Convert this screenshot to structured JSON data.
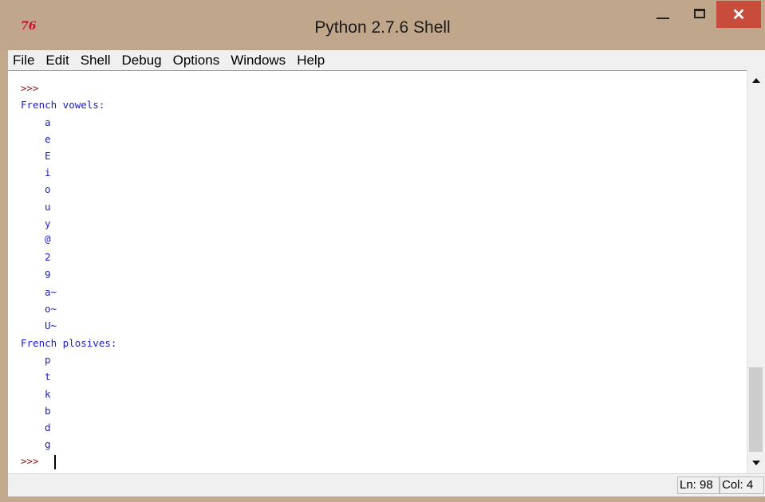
{
  "window": {
    "title": "Python 2.7.6 Shell",
    "app_icon": "76",
    "close_glyph": "✕"
  },
  "menu": [
    "File",
    "Edit",
    "Shell",
    "Debug",
    "Options",
    "Windows",
    "Help"
  ],
  "shell": {
    "prompt": ">>>",
    "header_vowels": "French vowels:",
    "vowels": [
      "a",
      "e",
      "E",
      "i",
      "o",
      "u",
      "y",
      "@",
      "2",
      "9",
      "a~",
      "o~",
      "U~"
    ],
    "header_plosives": "French plosives:",
    "plosives": [
      "p",
      "t",
      "k",
      "b",
      "d",
      "g"
    ]
  },
  "status": {
    "line": "Ln: 98",
    "col": "Col: 4"
  },
  "colors": {
    "title_bar": "#c0a68b",
    "close_button": "#c74c3c",
    "output_text": "#1a1acc",
    "prompt_text": "#8b1a1a"
  },
  "icons": [
    "idle-logo-icon",
    "minimize-icon",
    "maximize-icon",
    "close-icon",
    "scroll-up-icon",
    "scroll-down-icon"
  ]
}
